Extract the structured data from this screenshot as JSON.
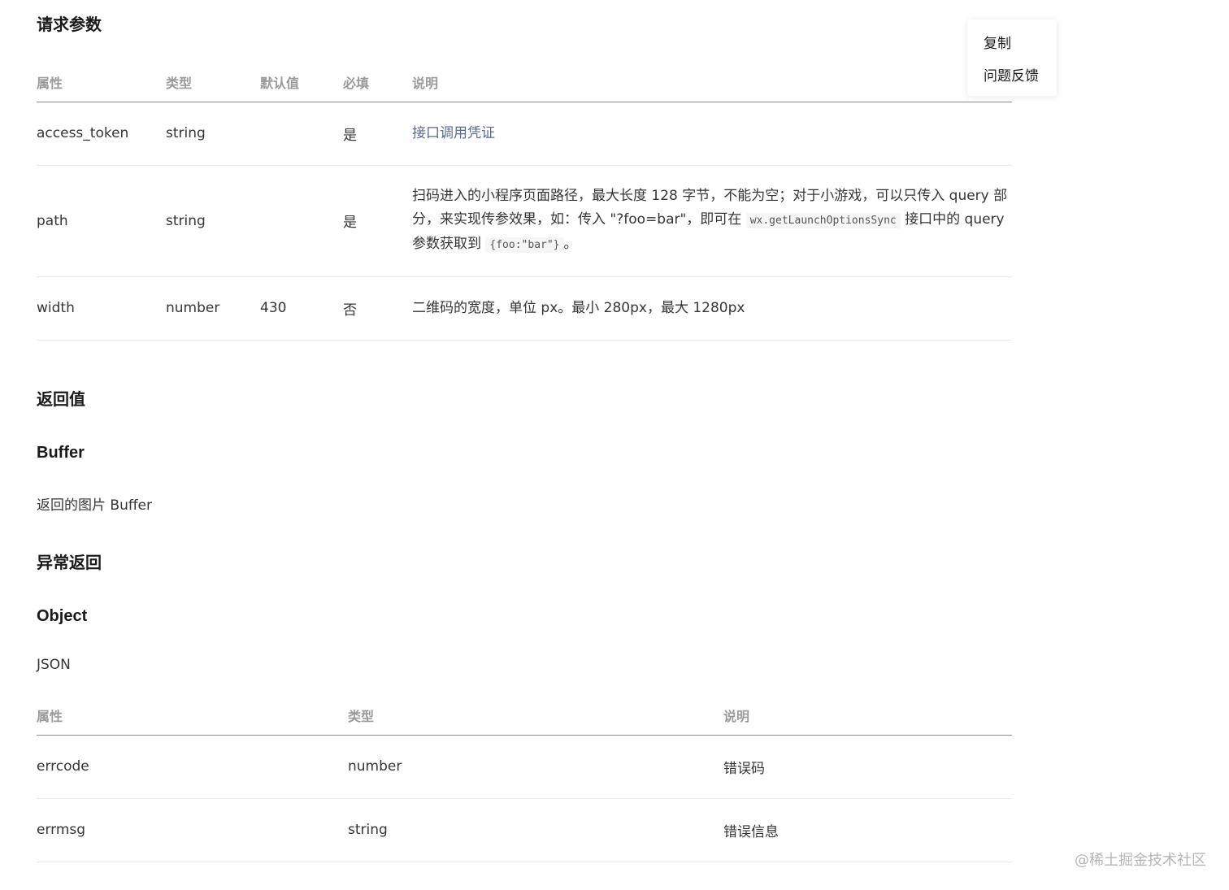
{
  "request_params": {
    "title": "请求参数",
    "headers": [
      "属性",
      "类型",
      "默认值",
      "必填",
      "说明"
    ],
    "rows": [
      {
        "name": "access_token",
        "type": "string",
        "default": "",
        "required": "是",
        "desc_link": "接口调用凭证"
      },
      {
        "name": "path",
        "type": "string",
        "default": "",
        "required": "是",
        "desc_text_1": "扫码进入的小程序页面路径，最大长度 128 字节，不能为空；对于小游戏，可以只传入 query 部分，来实现传参效果，如：传入 \"?foo=bar\"，即可在 ",
        "desc_code_1": "wx.getLaunchOptionsSync",
        "desc_text_2": " 接口中的 query 参数获取到 ",
        "desc_code_2": "{foo:\"bar\"}",
        "desc_text_3": "。"
      },
      {
        "name": "width",
        "type": "number",
        "default": "430",
        "required": "否",
        "desc": "二维码的宽度，单位 px。最小 280px，最大 1280px"
      }
    ]
  },
  "return_value": {
    "title": "返回值",
    "type_title": "Buffer",
    "text": "返回的图片 Buffer"
  },
  "error_return": {
    "title": "异常返回",
    "type_title": "Object",
    "text": "JSON",
    "headers": [
      "属性",
      "类型",
      "说明"
    ],
    "rows": [
      {
        "name": "errcode",
        "type": "number",
        "desc": "错误码"
      },
      {
        "name": "errmsg",
        "type": "string",
        "desc": "错误信息"
      }
    ]
  },
  "popover": {
    "copy": "复制",
    "feedback": "问题反馈"
  },
  "watermark": "@稀土掘金技术社区"
}
